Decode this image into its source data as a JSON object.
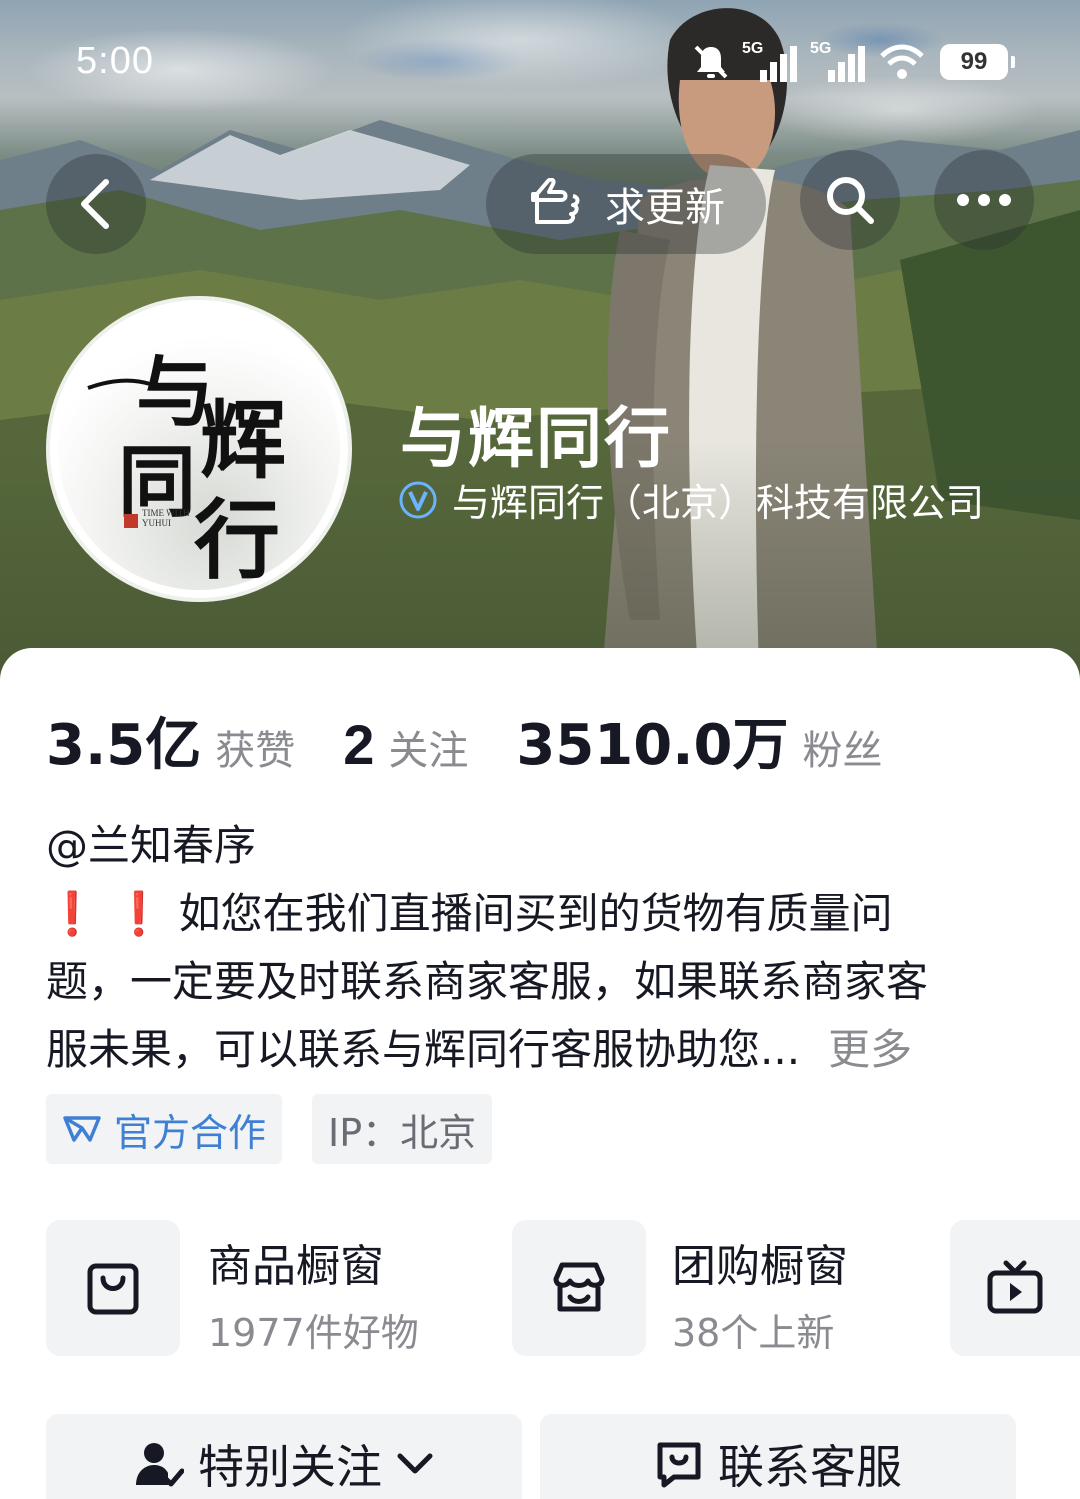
{
  "status_bar": {
    "time": "5:00",
    "battery": "99",
    "network_1": "5G",
    "network_2": "5G"
  },
  "nav": {
    "request_update_label": "求更新"
  },
  "profile": {
    "name": "与辉同行",
    "verification": "与辉同行（北京）科技有限公司",
    "avatar_text": [
      "与",
      "辉",
      "同",
      "行"
    ],
    "avatar_english": "TIME WITH YUHUI"
  },
  "stats": [
    {
      "value": "3.5亿",
      "label": "获赞"
    },
    {
      "value": "2",
      "label": "关注"
    },
    {
      "value": "3510.0万",
      "label": "粉丝"
    }
  ],
  "bio": {
    "mention": "@兰知春序",
    "line1": "如您在我们直播间买到的货物有质量问",
    "line2": "题，一定要及时联系商家客服，如果联系商家客",
    "line3": "服未果，可以联系与辉同行客服协助您...",
    "more": "更多"
  },
  "tags": {
    "official": "官方合作",
    "ip": "IP：北京"
  },
  "shop": [
    {
      "title": "商品橱窗",
      "subtitle": "1977件好物"
    },
    {
      "title": "团购橱窗",
      "subtitle": "38个上新"
    }
  ],
  "actions": {
    "follow": "特别关注",
    "contact": "联系客服"
  },
  "colors": {
    "accent_blue": "#3f7fd4",
    "alert_red": "#e8313b",
    "text_primary": "#161823",
    "text_secondary": "#8a8b91"
  }
}
